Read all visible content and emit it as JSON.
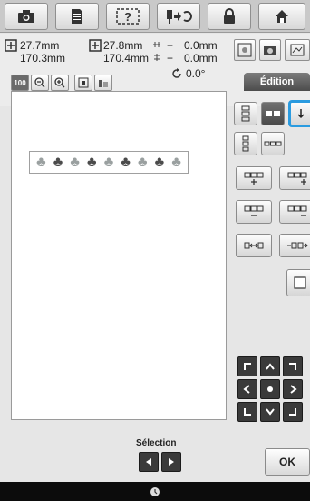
{
  "toolbar": {
    "icons": [
      "camera-icon",
      "page-icon",
      "help-icon",
      "needle-thread-icon",
      "lock-icon",
      "home-icon"
    ],
    "help_label": "?"
  },
  "info": {
    "width_value": "27.7mm",
    "height_value": "170.3mm",
    "width2_value": "27.8mm",
    "height2_value": "170.4mm",
    "offset_x_value": "0.0mm",
    "offset_y_value": "0.0mm",
    "offset_x_sign": "+",
    "offset_y_sign": "+",
    "angle_value": "0.0°",
    "zoom_label": "100"
  },
  "tabs": {
    "edition_label": "Édition"
  },
  "canvas": {
    "motif_glyphs": [
      "♣",
      "♣",
      "♣",
      "♣",
      "♣",
      "♣",
      "♣",
      "♣",
      "♣"
    ],
    "motif_colors": [
      "#9aa0a0",
      "#4b4b4b",
      "#9aa0a0",
      "#4b4b4b",
      "#9aa0a0",
      "#4b4b4b",
      "#9aa0a0",
      "#4b4b4b",
      "#9aa0a0"
    ]
  },
  "footer": {
    "selection_label": "Sélection",
    "ok_label": "OK"
  },
  "colors": {
    "highlight": "#2a9be0",
    "dark_button": "#3a3a3a"
  }
}
